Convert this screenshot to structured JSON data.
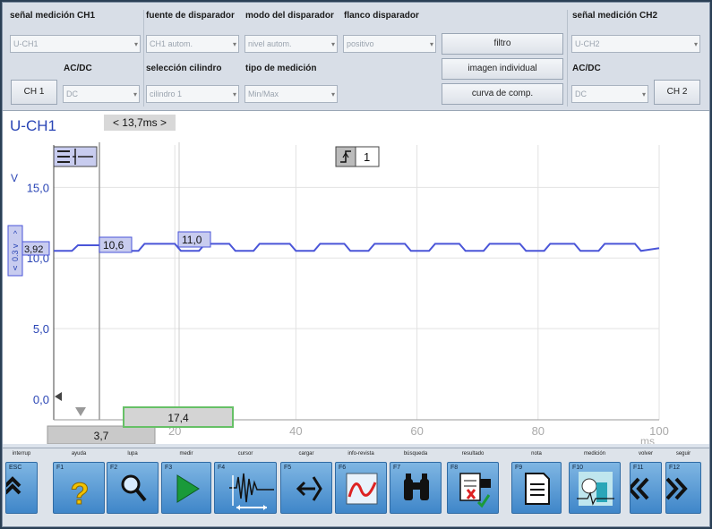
{
  "panel": {
    "ch1_signal_label": "señal medición CH1",
    "ch1_signal_value": "U-CH1",
    "trigger_source_label": "fuente de disparador",
    "trigger_source_value": "CH1 autom.",
    "trigger_mode_label": "modo del disparador",
    "trigger_mode_value": "nivel autom.",
    "trigger_edge_label": "flanco disparador",
    "trigger_edge_value": "positivo",
    "ch1_acdc_label": "AC/DC",
    "ch1_acdc_value": "DC",
    "cylinder_label": "selección cilindro",
    "cylinder_value": "cilindro 1",
    "meas_type_label": "tipo de medición",
    "meas_type_value": "Min/Max",
    "ch1_button": "CH 1",
    "filter_button": "filtro",
    "single_image_button": "imagen individual",
    "comp_curve_button": "curva de comp.",
    "ch2_signal_label": "señal medición CH2",
    "ch2_signal_value": "U-CH2",
    "ch2_acdc_label": "AC/DC",
    "ch2_acdc_value": "DC",
    "ch2_button": "CH 2"
  },
  "scope": {
    "channel": "U-CH1",
    "period": "< 13,7ms >",
    "unit_v": "V",
    "unit_ms": "ms",
    "y_ticks": [
      "15,0",
      "10,0",
      "5,0",
      "0,0"
    ],
    "x_ticks": [
      "20",
      "40",
      "60",
      "80",
      "100"
    ],
    "trigger_channel": "1",
    "offset_value": "3,92",
    "offset_marker": "0.3 v",
    "cursor_a_value": "10,6",
    "cursor_b_value": "11,0",
    "delta_value": "17,4",
    "cursor_time": "3,7"
  },
  "chart_data": {
    "type": "line",
    "ylabel": "V",
    "xlabel": "ms",
    "xlim": [
      0,
      100
    ],
    "ylim": [
      0,
      18
    ],
    "series": [
      {
        "x": [
          0,
          3,
          4,
          10,
          11,
          14,
          15,
          20,
          21,
          24,
          25,
          29,
          30,
          33,
          34,
          39,
          40,
          43,
          44,
          48,
          49,
          52,
          53,
          58,
          59,
          62,
          63,
          67,
          68,
          71,
          72,
          77,
          78,
          81,
          82,
          86,
          87,
          90,
          91,
          96,
          97,
          100
        ],
        "values": [
          10.5,
          10.5,
          10.9,
          10.9,
          10.5,
          10.5,
          11.0,
          11.0,
          10.5,
          10.5,
          11.0,
          11.0,
          10.5,
          10.5,
          11.0,
          11.0,
          10.5,
          10.5,
          11.0,
          11.0,
          10.5,
          10.5,
          11.0,
          11.0,
          10.5,
          10.5,
          11.0,
          11.0,
          10.5,
          10.5,
          11.0,
          11.0,
          10.5,
          10.5,
          11.0,
          11.0,
          10.5,
          10.5,
          11.0,
          11.0,
          10.5,
          10.7
        ]
      }
    ],
    "grid": true
  },
  "toolbar": {
    "items": [
      {
        "caption": "interrup",
        "key": "ESC",
        "icon": "double-up-chevron-icon"
      },
      {
        "caption": "ayuda",
        "key": "F1",
        "icon": "help-question-icon"
      },
      {
        "caption": "lupa",
        "key": "F2",
        "icon": "magnifier-icon"
      },
      {
        "caption": "medir",
        "key": "F3",
        "icon": "play-icon"
      },
      {
        "caption": "cursor",
        "key": "F4",
        "icon": "cursor-waveform-icon"
      },
      {
        "caption": "cargar",
        "key": "F5",
        "icon": "load-arrows-icon"
      },
      {
        "caption": "info-revista",
        "key": "F6",
        "icon": "signal-curve-icon"
      },
      {
        "caption": "búsqueda",
        "key": "F7",
        "icon": "binoculars-icon"
      },
      {
        "caption": "resultado",
        "key": "F8",
        "icon": "result-document-icon"
      },
      {
        "caption": "nota",
        "key": "F9",
        "icon": "note-document-icon"
      },
      {
        "caption": "medición",
        "key": "F10",
        "icon": "measurement-icon"
      },
      {
        "caption": "volver",
        "key": "F11",
        "icon": "back-chevron-icon"
      },
      {
        "caption": "seguir",
        "key": "F12",
        "icon": "forward-chevron-icon"
      }
    ]
  },
  "colors": {
    "trace": "#4a55d8",
    "channel_label": "#2a45b5",
    "button_blue": "#3f86c9",
    "delta_box_border": "#66c066"
  }
}
